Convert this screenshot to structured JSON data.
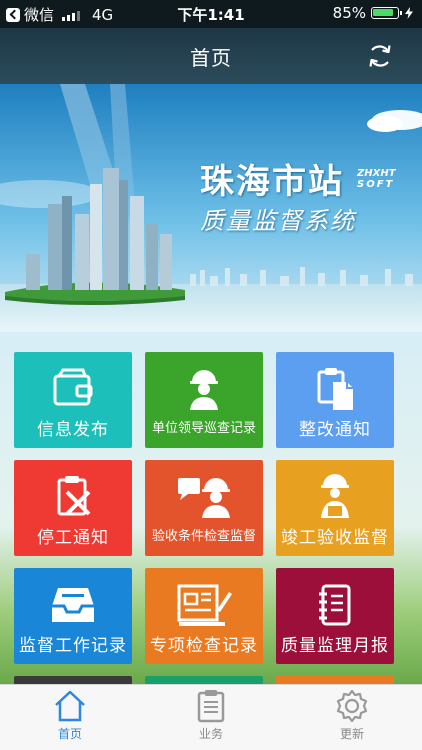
{
  "status_bar": {
    "carrier": "微信",
    "network": "4G",
    "time": "下午1:41",
    "battery": "85%"
  },
  "nav": {
    "title": "首页"
  },
  "banner": {
    "title": "珠海市站",
    "brand_line1": "ZHXHT",
    "brand_line2": "SOFT",
    "subtitle": "质量监督系统"
  },
  "tiles": [
    {
      "label": "信息发布",
      "color": "#1cbfba",
      "icon": "wallet-icon"
    },
    {
      "label": "单位领导巡查记录",
      "color": "#3aa52a",
      "icon": "worker-icon"
    },
    {
      "label": "整改通知",
      "color": "#5c9ef0",
      "icon": "clipboard-icon"
    },
    {
      "label": "停工通知",
      "color": "#ef3a34",
      "icon": "stop-work-icon"
    },
    {
      "label": "验收条件检查监督",
      "color": "#e3542c",
      "icon": "worker-chat-icon"
    },
    {
      "label": "竣工验收监督",
      "color": "#e8a020",
      "icon": "worker-report-icon"
    },
    {
      "label": "监督工作记录",
      "color": "#1a86d8",
      "icon": "inbox-tray-icon"
    },
    {
      "label": "专项检查记录",
      "color": "#ea7a22",
      "icon": "blueprint-ruler-icon"
    },
    {
      "label": "质量监理月报",
      "color": "#9c0f3a",
      "icon": "notebook-icon"
    }
  ],
  "tabs": [
    {
      "label": "首页",
      "icon": "home-icon",
      "active": true
    },
    {
      "label": "业务",
      "icon": "clipboard-list-icon",
      "active": false
    },
    {
      "label": "更新",
      "icon": "gear-icon",
      "active": false
    }
  ]
}
